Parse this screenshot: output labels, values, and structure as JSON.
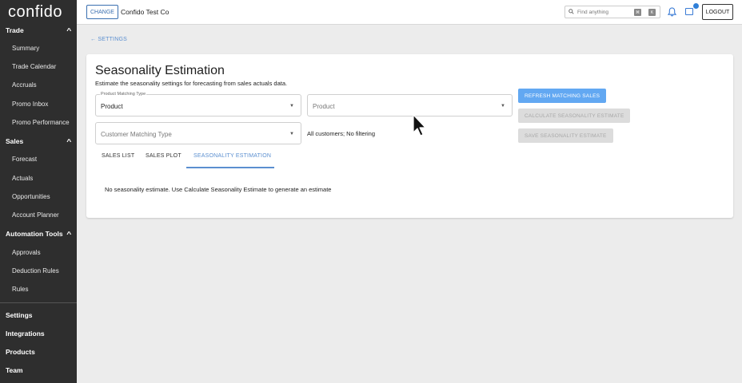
{
  "sidebar": {
    "logo": "confido",
    "sections": [
      {
        "title": "Trade",
        "collapsible": true,
        "items": [
          "Summary",
          "Trade Calendar",
          "Accruals",
          "Promo Inbox",
          "Promo Performance"
        ]
      },
      {
        "title": "Sales",
        "collapsible": true,
        "items": [
          "Forecast",
          "Actuals",
          "Opportunities",
          "Account Planner"
        ]
      },
      {
        "title": "Automation Tools",
        "collapsible": true,
        "items": [
          "Approvals",
          "Deduction Rules",
          "Rules"
        ]
      }
    ],
    "bottom_links": [
      "Settings",
      "Integrations",
      "Products",
      "Team"
    ]
  },
  "topbar": {
    "change_label": "CHANGE",
    "company": "Confido Test Co",
    "search_placeholder": "Find anything",
    "shortcut_keys": [
      "⌘",
      "K"
    ],
    "logout_label": "LOGOUT"
  },
  "main": {
    "back_label": "SETTINGS",
    "title": "Seasonality Estimation",
    "subtitle": "Estimate the seasonality settings for forecasting from sales actuals data.",
    "product_matching_type": {
      "label": "Product Matching Type",
      "value": "Product"
    },
    "product_select": {
      "placeholder": "Product"
    },
    "customer_matching_type": {
      "placeholder": "Customer Matching Type"
    },
    "customer_filter_text": "All customers; No filtering",
    "buttons": {
      "refresh": "REFRESH MATCHING SALES",
      "calculate": "CALCULATE SEASONALITY ESTIMATE",
      "save": "SAVE SEASONALITY ESTIMATE"
    },
    "tabs": [
      "SALES LIST",
      "SALES PLOT",
      "SEASONALITY ESTIMATION"
    ],
    "active_tab": "SEASONALITY ESTIMATION",
    "empty_message": "No seasonality estimate. Use Calculate Seasonality Estimate to generate an estimate"
  },
  "colors": {
    "sidebar_bg": "#2e2e2e",
    "accent": "#5b8fd0",
    "primary_button": "#62a8f2",
    "disabled_button": "#dcdcdc"
  }
}
